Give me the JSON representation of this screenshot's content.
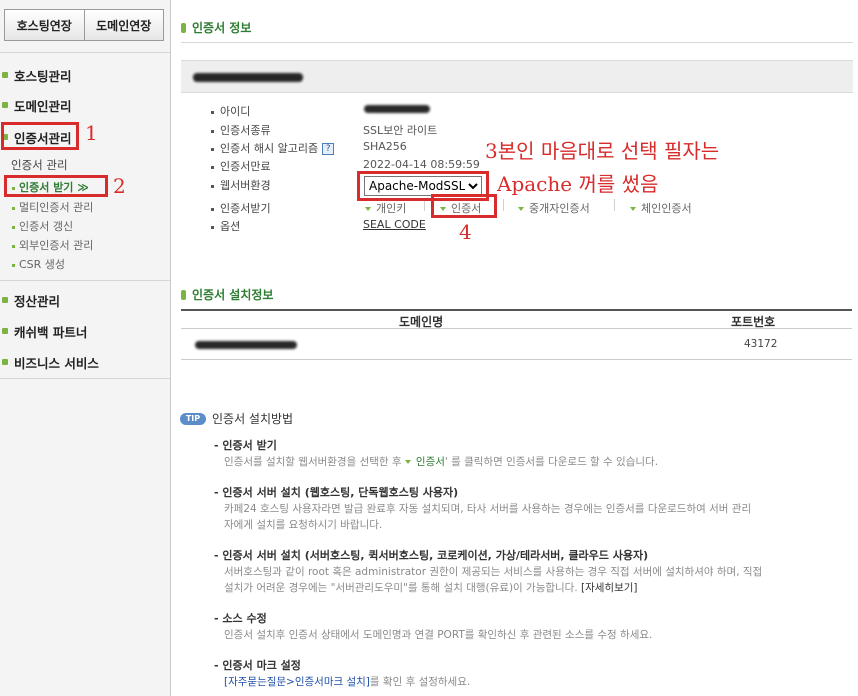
{
  "sidebar": {
    "top_buttons": [
      "호스팅연장",
      "도메인연장"
    ],
    "menu": {
      "hosting": "호스팅관리",
      "domain": "도메인관리",
      "cert": "인증서관리",
      "settle": "정산관리",
      "cashback": "캐쉬백 파트너",
      "business": "비즈니스 서비스"
    },
    "cert_sub_title": "인증서 관리",
    "cert_sub_items": [
      "인증서 받기 ≫",
      "멀티인증서 관리",
      "인증서 갱신",
      "외부인증서 관리",
      "CSR 생성"
    ]
  },
  "cert_info": {
    "title": "인증서 정보",
    "labels": [
      "아이디",
      "인증서종류",
      "인증서 해시 알고리즘",
      "인증서만료",
      "웹서버환경",
      "인증서받기",
      "옵션"
    ],
    "type": "SSL보안 라이트",
    "hash": "SHA256",
    "expiry": "2022-04-14 08:59:59",
    "server_env": "Apache-ModSSL",
    "downloads": [
      "개인키",
      "인증서",
      "중개자인증서",
      "체인인증서"
    ],
    "option": "SEAL CODE",
    "help_icon": "?"
  },
  "install_info": {
    "title": "인증서 설치정보",
    "columns": [
      "도메인명",
      "포트번호"
    ],
    "rows": [
      {
        "port": "43172"
      }
    ]
  },
  "tip": {
    "badge": "TIP",
    "title": "인증서 설치방법",
    "steps": [
      {
        "heading": "- 인증서 받기",
        "lines": [
          "인증서를 설치할 웹서버환경을 선택한 후 ",
          "인증서",
          "' 를 클릭하면 인증서를 다운로드 할 수 있습니다."
        ]
      },
      {
        "heading": "- 인증서 서버 설치 (웹호스팅, 단독웹호스팅 사용자)",
        "lines": [
          "카페24 호스팅 사용자라면 발급 완료후 자동 설치되며, 타사 서버를 사용하는 경우에는 인증서를 다운로드하여 서버 관리",
          "자에게 설치를 요청하시기 바랍니다."
        ]
      },
      {
        "heading": "- 인증서 서버 설치 (서버호스팅, 퀵서버호스팅, 코로케이션, 가상/테라서버, 클라우드 사용자)",
        "lines": [
          "서버호스팅과 같이 root 혹은 administrator 권한이 제공되는 서비스를 사용하는 경우 직접 서버에 설치하셔야 하며, 직접",
          "설치가 어려운 경우에는 \"서버관리도우미\"를 통해 설치 대행(유료)이 가능합니다.",
          "[자세히보기]"
        ]
      },
      {
        "heading": "- 소스 수정",
        "lines": [
          "인증서 설치후 인증서 상태에서 도메인명과 연결 PORT를 확인하신 후 관련된 소스를 수정 하세요."
        ]
      },
      {
        "heading": "- 인증서 마크 설정",
        "lines": [
          "[자주묻는질문>인증서마크 설치]",
          "를 확인 후 설정하세요."
        ]
      }
    ]
  },
  "annotations": {
    "n1": "1",
    "n2": "2",
    "n4": "4",
    "line1": "3본인 마음대로 선택 필자는",
    "line2": "Apache 꺼를 썼음",
    "color": "#d82b2b"
  },
  "colors": {
    "accent_green": "#2e7d32",
    "dot_green": "#7cb342",
    "annotation_red": "#d82b2b"
  }
}
